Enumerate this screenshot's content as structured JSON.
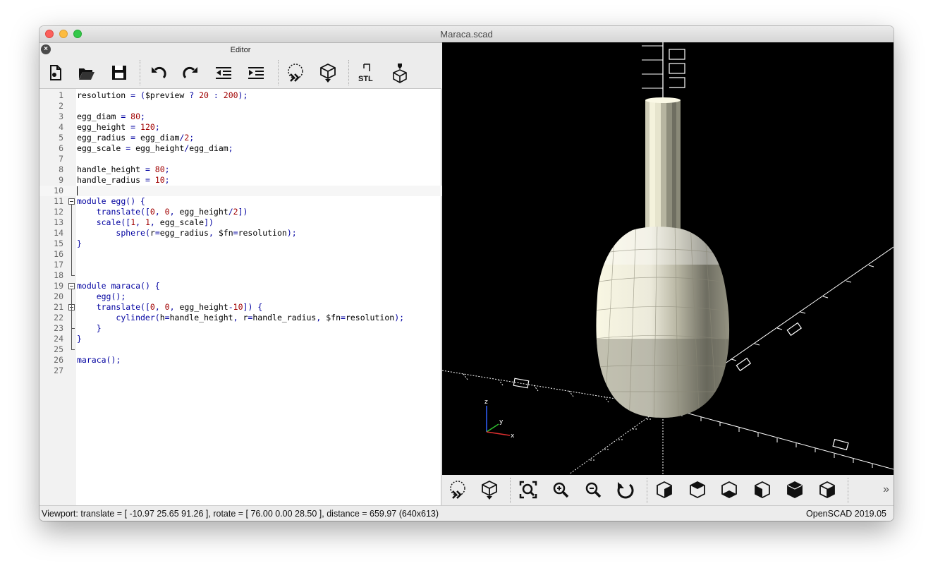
{
  "window": {
    "title": "Maraca.scad"
  },
  "editor": {
    "title": "Editor",
    "toolbar": [
      "new-file-icon",
      "open-file-icon",
      "save-icon",
      "undo-icon",
      "redo-icon",
      "unindent-icon",
      "indent-icon",
      "preview-icon",
      "render-icon",
      "export-stl-icon",
      "send-to-print-icon"
    ],
    "stl_label": "STL",
    "lines": [
      {
        "n": "1",
        "t": "resolution = ($preview ? 20 : 200);"
      },
      {
        "n": "2",
        "t": ""
      },
      {
        "n": "3",
        "t": "egg_diam = 80;"
      },
      {
        "n": "4",
        "t": "egg_height = 120;"
      },
      {
        "n": "5",
        "t": "egg_radius = egg_diam/2;"
      },
      {
        "n": "6",
        "t": "egg_scale = egg_height/egg_diam;"
      },
      {
        "n": "7",
        "t": ""
      },
      {
        "n": "8",
        "t": "handle_height = 80;"
      },
      {
        "n": "9",
        "t": "handle_radius = 10;"
      },
      {
        "n": "10",
        "t": ""
      },
      {
        "n": "11",
        "t": "module egg() {"
      },
      {
        "n": "12",
        "t": "    translate([0, 0, egg_height/2])"
      },
      {
        "n": "13",
        "t": "    scale([1, 1, egg_scale])"
      },
      {
        "n": "14",
        "t": "        sphere(r=egg_radius, $fn=resolution);"
      },
      {
        "n": "15",
        "t": "}"
      },
      {
        "n": "16",
        "t": ""
      },
      {
        "n": "17",
        "t": ""
      },
      {
        "n": "18",
        "t": ""
      },
      {
        "n": "19",
        "t": "module maraca() {"
      },
      {
        "n": "20",
        "t": "    egg();"
      },
      {
        "n": "21",
        "t": "    translate([0, 0, egg_height-10]) {"
      },
      {
        "n": "22",
        "t": "        cylinder(h=handle_height, r=handle_radius, $fn=resolution);"
      },
      {
        "n": "23",
        "t": "    }"
      },
      {
        "n": "24",
        "t": "}"
      },
      {
        "n": "25",
        "t": ""
      },
      {
        "n": "26",
        "t": "maraca();"
      },
      {
        "n": "27",
        "t": ""
      }
    ]
  },
  "viewer": {
    "axis_labels": {
      "z": "z",
      "y": "y",
      "x": "x"
    },
    "toolbar": [
      "preview-icon",
      "render-icon",
      "view-all-icon",
      "zoom-in-icon",
      "zoom-out-icon",
      "reset-view-icon",
      "view-right-icon",
      "view-top-icon",
      "view-bottom-icon",
      "view-left-icon",
      "view-front-icon",
      "view-back-icon"
    ],
    "more": "»"
  },
  "status": {
    "viewport": "Viewport: translate = [ -10.97 25.65 91.26 ], rotate = [ 76.00 0.00 28.50 ], distance = 659.97 (640x613)",
    "version": "OpenSCAD 2019.05"
  },
  "colors": {
    "background": "#000000",
    "model": "#f4f2dc",
    "keyword": "#0000a0",
    "number": "#a00000"
  }
}
